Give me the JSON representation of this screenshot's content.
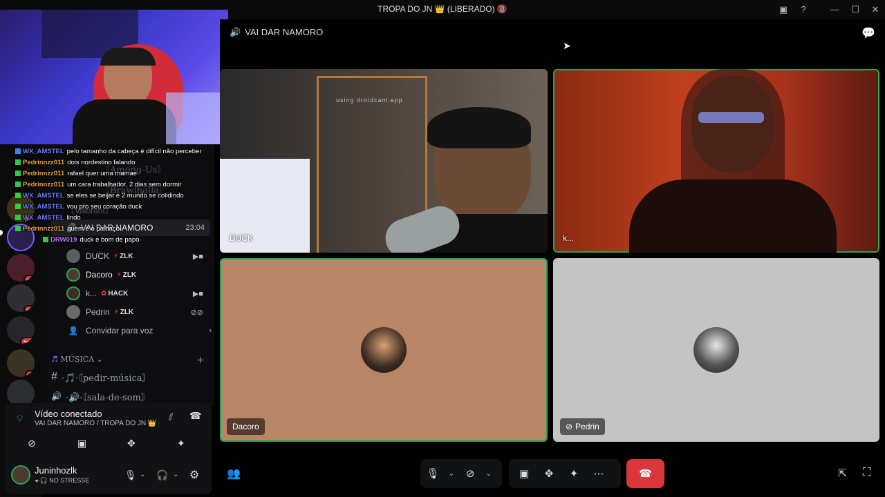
{
  "window": {
    "title": "TROPA DO JN 👑 (LIBERADO) 🔞"
  },
  "call": {
    "channel_name": "VAI DAR NAMORO",
    "tiles": [
      {
        "name": "DUCK"
      },
      {
        "name": "k..."
      },
      {
        "name": "Dacoro"
      },
      {
        "name": "Pedrin"
      }
    ],
    "watermark": "using droidcam.app"
  },
  "sidebar": {
    "faded_channels": [
      "〘Among-Us〙",
      "〘Brawlhalla〙",
      "〘Valorant〙"
    ],
    "voice_channel": {
      "name": "VAI DAR NAMORO",
      "time": "23:04"
    },
    "voice_users": [
      {
        "name": "DUCK",
        "tag": "ZLK",
        "icon": "video-icon"
      },
      {
        "name": "Dacoro",
        "tag": "ZLK",
        "icon": ""
      },
      {
        "name": "k...",
        "tag": "HACK",
        "icon": "video-icon"
      },
      {
        "name": "Pedrin",
        "tag": "ZLK",
        "icon": "mute-deafen-icon"
      }
    ],
    "invite_label": "Convidar para voz",
    "category": "MÚSICA",
    "channels": [
      {
        "prefix": "#",
        "name": "·🎵·〘pedir-música〙"
      },
      {
        "prefix": "🔊",
        "name": "·🔊·〘sala-de-som〙"
      }
    ]
  },
  "servers": {
    "badges": [
      "10",
      "38",
      "37",
      "212",
      "1"
    ]
  },
  "voice_panel": {
    "status": "Vídeo conectado",
    "location": "VAI DAR NAMORO / TROPA DO JN 👑 (..."
  },
  "user_panel": {
    "username": "Juninhozlk",
    "status": "NO STRESSE"
  },
  "chat": [
    {
      "user": "WX_AMSTEL",
      "color": "#6b7cff",
      "text": "pelo tamanho da cabeça é difícil não perceber"
    },
    {
      "user": "Pedrinnzz011",
      "color": "#e6a23c",
      "text": "dois nordestino falando"
    },
    {
      "user": "Pedrinnzz011",
      "color": "#e6a23c",
      "text": "rafael quer uma mamae"
    },
    {
      "user": "Pedrinnzz011",
      "color": "#e6a23c",
      "text": "um cara trabalhador, 2 dias sem dormir"
    },
    {
      "user": "WX_AMSTEL",
      "color": "#6b7cff",
      "text": "se eles se beijar e 2 mundo se colidindo"
    },
    {
      "user": "WX_AMSTEL",
      "color": "#6b7cff",
      "text": "vou pro seu coração duck"
    },
    {
      "user": "WX_AMSTEL",
      "color": "#6b7cff",
      "text": "lindo"
    },
    {
      "user": "Pedrinnzz011",
      "color": "#e6a23c",
      "text": "quem é o palhaço"
    },
    {
      "user": "DRW019",
      "color": "#b57cff",
      "text": "duck e bom de papo"
    }
  ]
}
